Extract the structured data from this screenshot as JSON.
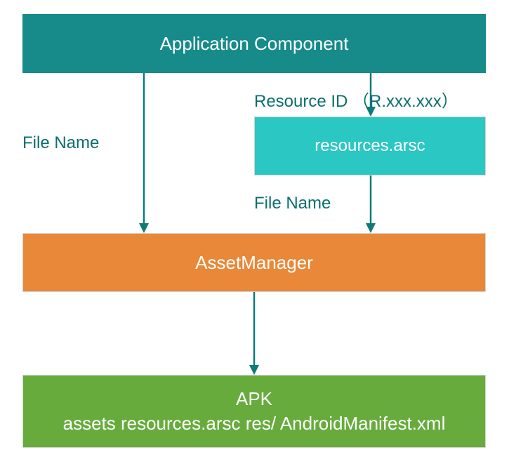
{
  "boxes": {
    "app_component": "Application Component",
    "resources_arsc": "resources.arsc",
    "asset_manager": "AssetManager",
    "apk_line1": "APK",
    "apk_line2": "assets resources.arsc res/ AndroidManifest.xml"
  },
  "labels": {
    "resource_id": "Resource ID （R.xxx.xxx）",
    "file_name_left": "File Name",
    "file_name_center": "File Name"
  }
}
